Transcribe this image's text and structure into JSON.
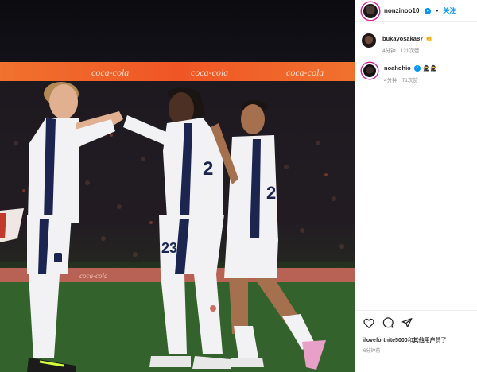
{
  "post": {
    "author": "nonzinoo10",
    "follow_label": "关注",
    "separator": "•"
  },
  "comments": [
    {
      "user": "bukayosaka87",
      "text": "👏",
      "time": "4分钟",
      "likes": "121次赞"
    },
    {
      "user": "noahohio",
      "text": "🥷🥷",
      "time": "4分钟",
      "likes": "71次赞"
    }
  ],
  "footer": {
    "liked_user": "ilovefortnite5000",
    "liked_mid": "和",
    "liked_others": "其他用户",
    "liked_tail": "赞了",
    "time": "6分钟前"
  },
  "photo": {
    "shirt_numbers": [
      "2",
      "23",
      "2"
    ],
    "board_text": [
      "coca-cola",
      "coca-cola",
      "coca-cola",
      "coca-cola"
    ]
  },
  "colors": {
    "accent": "#0095f6",
    "verified": "#0095f6",
    "board": "#e8501f"
  },
  "icons": [
    "heart-icon",
    "comment-icon",
    "share-icon",
    "verified-icon"
  ]
}
